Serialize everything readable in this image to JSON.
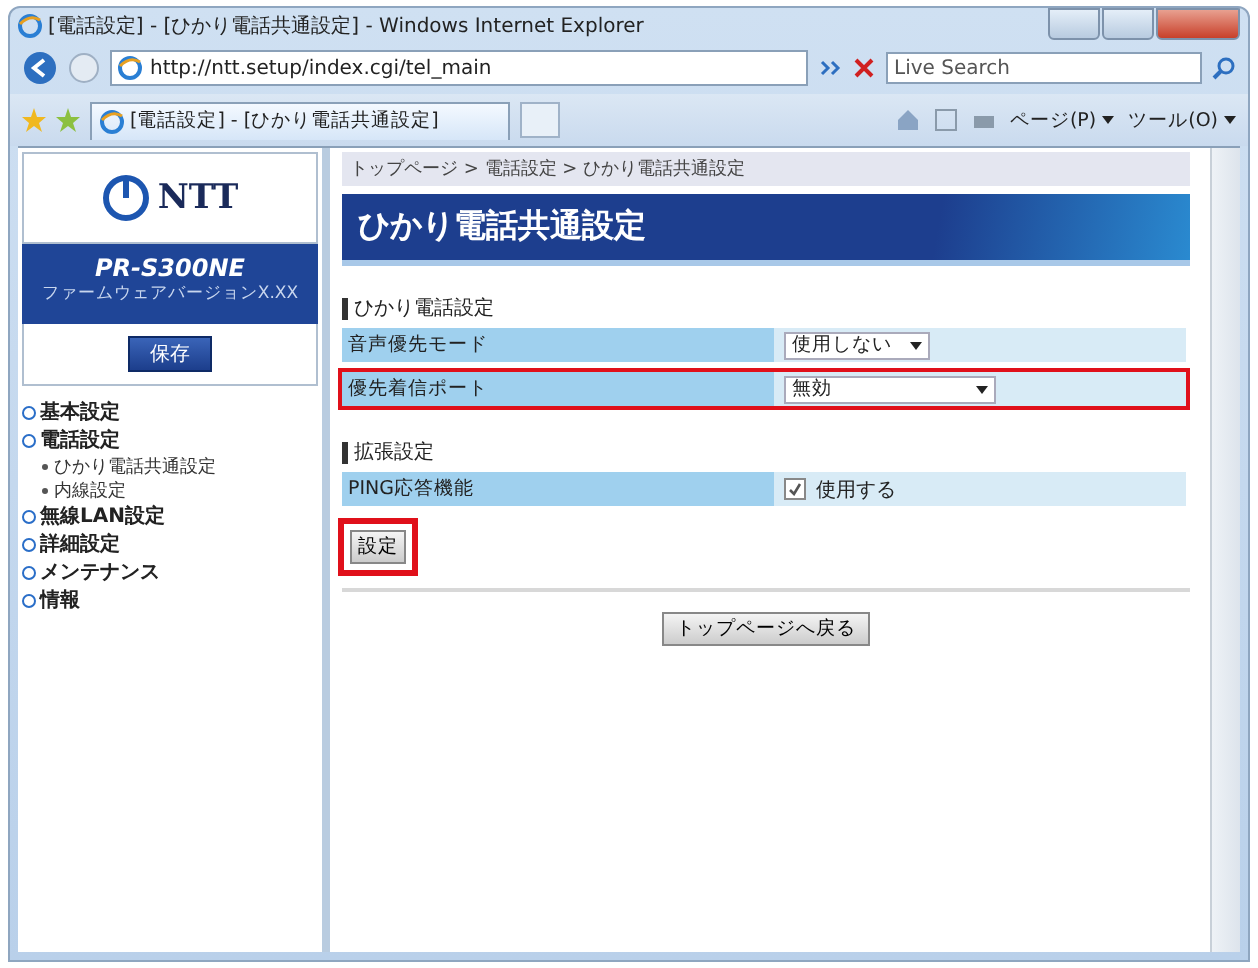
{
  "window": {
    "title": "[電話設定] - [ひかり電話共通設定] - Windows Internet Explorer"
  },
  "address_bar": {
    "url": "http://ntt.setup/index.cgi/tel_main",
    "search_placeholder": "Live Search"
  },
  "tab": {
    "label": "[電話設定] - [ひかり電話共通設定]"
  },
  "toolbar": [
    "ページ(P)",
    "ツール(O)"
  ],
  "sidebar": {
    "logo": "NTT",
    "model": "PR-S300NE",
    "firmware": "ファームウェアバージョンX.XX",
    "save_button": "保存",
    "items": [
      {
        "label": "基本設定"
      },
      {
        "label": "電話設定",
        "children": [
          {
            "label": "ひかり電話共通設定"
          },
          {
            "label": "内線設定"
          }
        ]
      },
      {
        "label": "無線LAN設定"
      },
      {
        "label": "詳細設定"
      },
      {
        "label": "メンテナンス"
      },
      {
        "label": "情報"
      }
    ]
  },
  "breadcrumb": "トップページ > 電話設定 > ひかり電話共通設定",
  "heading": "ひかり電話共通設定",
  "sections": [
    {
      "title": "ひかり電話設定",
      "rows": [
        {
          "kind": "select",
          "label": "音声優先モード",
          "value": "使用しない",
          "highlighted": false,
          "wide": false
        },
        {
          "kind": "select",
          "label": "優先着信ポート",
          "value": "無効",
          "highlighted": true,
          "wide": true
        }
      ]
    },
    {
      "title": "拡張設定",
      "rows": [
        {
          "kind": "checkbox",
          "label": "PING応答機能",
          "value": "使用する",
          "checked": true,
          "highlighted": false
        }
      ]
    }
  ],
  "submit_button": {
    "label": "設定",
    "highlighted": true
  },
  "back_button": "トップページへ戻る"
}
